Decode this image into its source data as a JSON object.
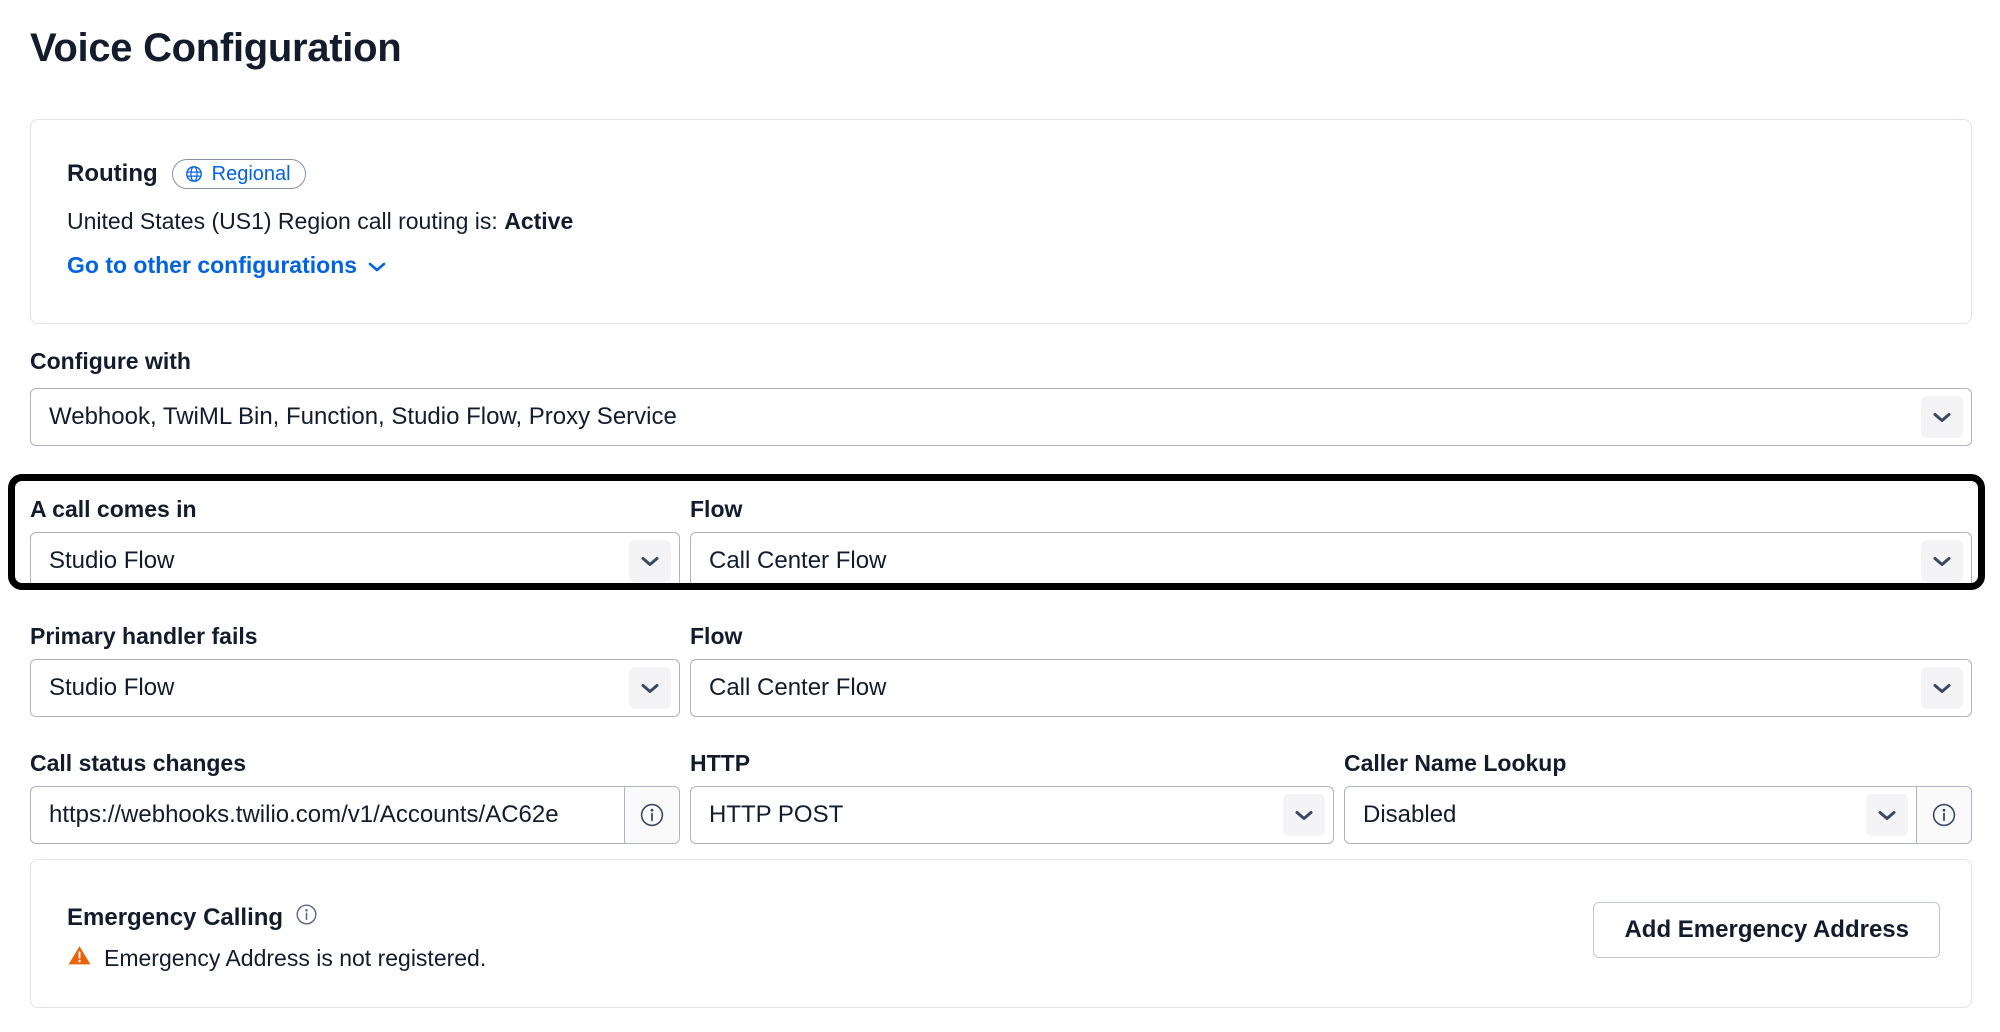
{
  "page": {
    "title": "Voice Configuration"
  },
  "routing": {
    "label": "Routing",
    "badge_label": "Regional",
    "badge_icon": "globe-icon",
    "status_prefix": "United States (US1) Region call routing is: ",
    "status_value": "Active",
    "link_label": "Go to other configurations",
    "link_icon": "chevron-down-icon",
    "link_color": "#0263e0"
  },
  "configure_with": {
    "label": "Configure with",
    "value": "Webhook, TwiML Bin, Function, Studio Flow, Proxy Service",
    "icon": "chevron-down-icon"
  },
  "call_comes_in": {
    "label": "A call comes in",
    "value": "Studio Flow",
    "icon": "chevron-down-icon",
    "highlighted": true,
    "highlight_color": "#000000"
  },
  "call_comes_in_flow": {
    "label": "Flow",
    "value": "Call Center Flow",
    "icon": "chevron-down-icon"
  },
  "primary_handler_fails": {
    "label": "Primary handler fails",
    "value": "Studio Flow",
    "icon": "chevron-down-icon"
  },
  "primary_handler_fails_flow": {
    "label": "Flow",
    "value": "Call Center Flow",
    "icon": "chevron-down-icon"
  },
  "call_status_changes": {
    "label": "Call status changes",
    "value": "https://webhooks.twilio.com/v1/Accounts/AC62e",
    "info_icon": "info-icon"
  },
  "http_method": {
    "label": "HTTP",
    "value": "HTTP POST",
    "icon": "chevron-down-icon"
  },
  "caller_name_lookup": {
    "label": "Caller Name Lookup",
    "value": "Disabled",
    "icon": "chevron-down-icon",
    "info_icon": "info-icon"
  },
  "emergency": {
    "title": "Emergency Calling",
    "info_icon": "info-icon",
    "warning_icon": "warning-triangle-icon",
    "warning_color": "#e8630a",
    "warning_text": "Emergency Address is not registered.",
    "button_label": "Add Emergency Address"
  }
}
